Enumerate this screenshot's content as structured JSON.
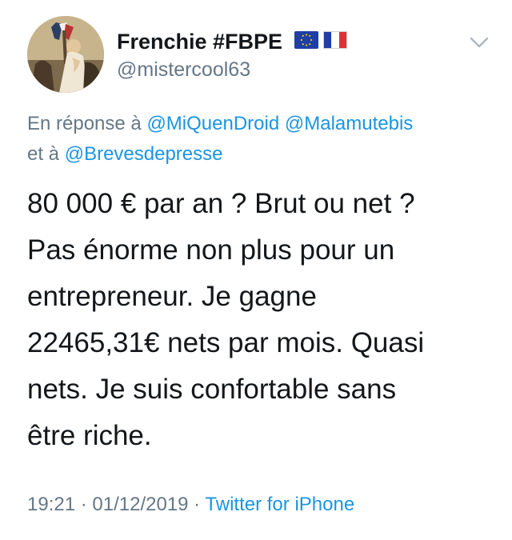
{
  "author": {
    "display_name": "Frenchie #FBPE",
    "username": "@mistercool63",
    "flags": [
      "eu-flag-icon",
      "france-flag-icon"
    ]
  },
  "reply": {
    "prefix": "En réponse à ",
    "mention_1": "@MiQuenDroid",
    "mention_2": "@Malamutebis",
    "conjunction": "et à ",
    "mention_3": "@Brevesdepresse"
  },
  "tweet": {
    "lines": [
      "80 000 € par an ? Brut ou net ?",
      "Pas énorme non plus pour un",
      "entrepreneur. Je gagne",
      "22465,31€ nets par mois. Quasi",
      "nets. Je suis confortable sans",
      "être riche."
    ]
  },
  "meta": {
    "time": "19:21",
    "separator_1": " · ",
    "date": "01/12/2019",
    "separator_2": " · ",
    "source": "Twitter for iPhone"
  },
  "colors": {
    "link": "#1b95e0",
    "secondary_text": "#657786",
    "primary_text": "#14171a"
  }
}
